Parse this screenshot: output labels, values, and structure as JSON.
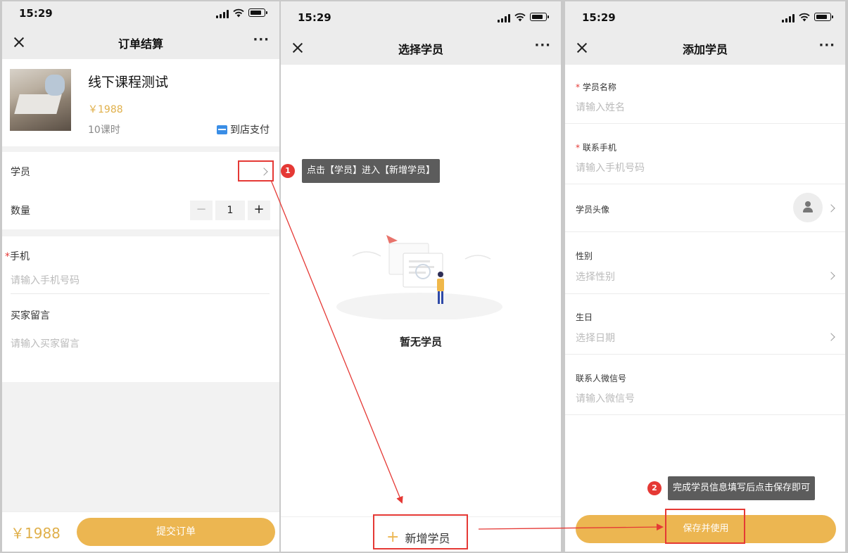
{
  "colors": {
    "accent": "#ecb651",
    "annotation_red": "#e53935",
    "callout_bg": "#5c5c5c"
  },
  "screen1": {
    "status_time": "15:29",
    "nav_title": "订单结算",
    "more": "···",
    "product_title": "线下课程测试",
    "product_price": "￥1988",
    "product_lessons": "10课时",
    "pay_method": "到店支付",
    "student_label": "学员",
    "qty_label": "数量",
    "qty_minus": "−",
    "qty_value": "1",
    "qty_plus": "+",
    "required_mark": "*",
    "phone_label": "手机",
    "phone_placeholder": "请输入手机号码",
    "note_label": "买家留言",
    "note_placeholder": "请输入买家留言",
    "total": "￥1988",
    "submit_label": "提交订单"
  },
  "screen2": {
    "status_time": "15:29",
    "nav_title": "选择学员",
    "more": "···",
    "empty_text": "暂无学员",
    "add_icon": "+",
    "add_label": "新增学员"
  },
  "screen3": {
    "status_time": "15:29",
    "nav_title": "添加学员",
    "more": "···",
    "required_mark": "*",
    "name_label": "学员名称",
    "name_placeholder": "请输入姓名",
    "phone_label": "联系手机",
    "phone_placeholder": "请输入手机号码",
    "avatar_label": "学员头像",
    "gender_label": "性别",
    "gender_placeholder": "选择性别",
    "birthday_label": "生日",
    "birthday_placeholder": "选择日期",
    "wechat_label": "联系人微信号",
    "wechat_placeholder": "请输入微信号",
    "save_label": "保存并使用"
  },
  "annotations": {
    "step1_number": "1",
    "step1_text": "点击【学员】进入【新增学员】",
    "step2_number": "2",
    "step2_text": "完成学员信息填写后点击保存即可"
  }
}
